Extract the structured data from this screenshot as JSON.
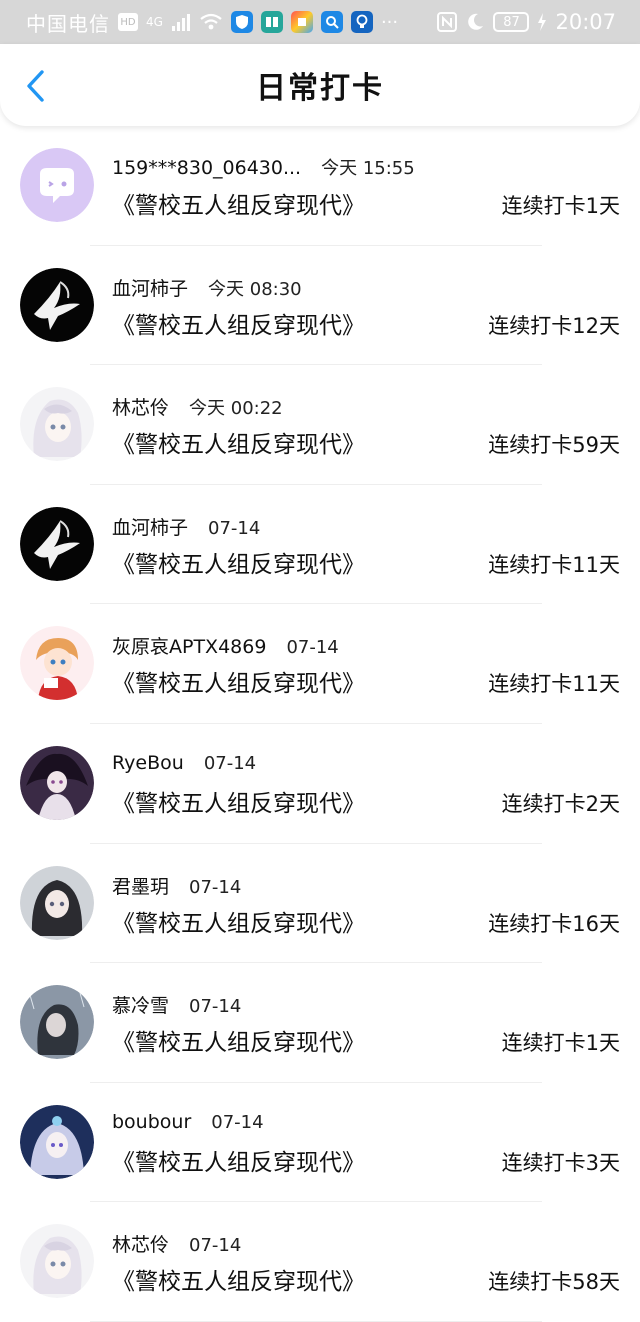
{
  "status_bar": {
    "carrier": "中国电信",
    "hd_label": "HD",
    "network_label": "4G",
    "battery": "87",
    "time": "20:07"
  },
  "header": {
    "title": "日常打卡"
  },
  "items": [
    {
      "name": "159***830_06430...",
      "time": "今天 15:55",
      "book": "《警校五人组反穿现代》",
      "streak": "连续打卡1天",
      "avatar": "chat-bubble"
    },
    {
      "name": "血河柿子",
      "time": "今天 08:30",
      "book": "《警校五人组反穿现代》",
      "streak": "连续打卡12天",
      "avatar": "dove"
    },
    {
      "name": "林芯伶",
      "time": "今天 00:22",
      "book": "《警校五人组反穿现代》",
      "streak": "连续打卡59天",
      "avatar": "anime-white"
    },
    {
      "name": "血河柿子",
      "time": "07-14",
      "book": "《警校五人组反穿现代》",
      "streak": "连续打卡11天",
      "avatar": "dove"
    },
    {
      "name": "灰原哀APTX4869",
      "time": "07-14",
      "book": "《警校五人组反穿现代》",
      "streak": "连续打卡11天",
      "avatar": "anime-red"
    },
    {
      "name": "RyeBou",
      "time": "07-14",
      "book": "《警校五人组反穿现代》",
      "streak": "连续打卡2天",
      "avatar": "anime-dark"
    },
    {
      "name": "君墨玥",
      "time": "07-14",
      "book": "《警校五人组反穿现代》",
      "streak": "连续打卡16天",
      "avatar": "anime-grey"
    },
    {
      "name": "慕冷雪",
      "time": "07-14",
      "book": "《警校五人组反穿现代》",
      "streak": "连续打卡1天",
      "avatar": "anime-rain"
    },
    {
      "name": "boubour",
      "time": "07-14",
      "book": "《警校五人组反穿现代》",
      "streak": "连续打卡3天",
      "avatar": "anime-blue"
    },
    {
      "name": "林芯伶",
      "time": "07-14",
      "book": "《警校五人组反穿现代》",
      "streak": "连续打卡58天",
      "avatar": "anime-white"
    }
  ]
}
